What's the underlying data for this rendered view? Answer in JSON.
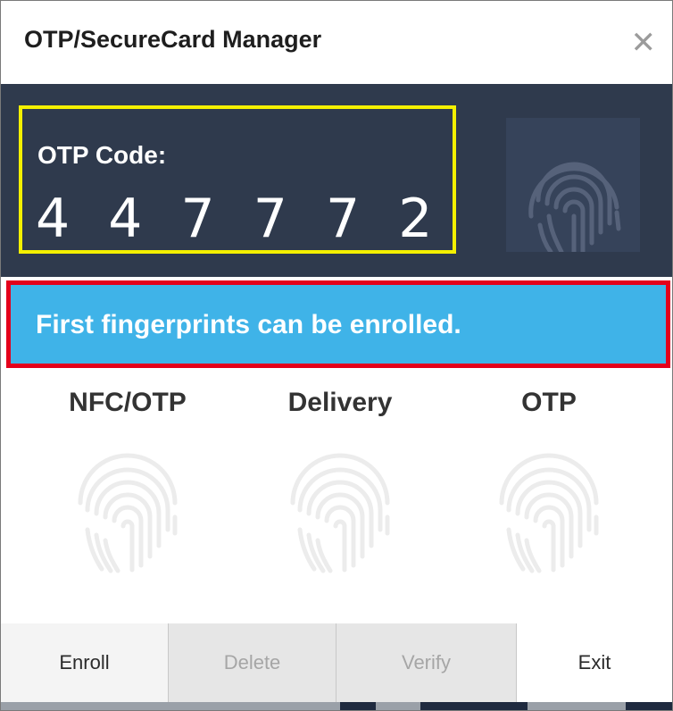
{
  "window": {
    "title": "OTP/SecureCard Manager",
    "close_label": "✕"
  },
  "otp": {
    "label": "OTP Code:",
    "code": "4 4 7 7 7 2"
  },
  "status": {
    "message": "First fingerprints can be enrolled."
  },
  "fingerprints": [
    {
      "label": "NFC/OTP",
      "icon": "fingerprint-icon"
    },
    {
      "label": "Delivery",
      "icon": "fingerprint-icon"
    },
    {
      "label": "OTP",
      "icon": "fingerprint-icon"
    }
  ],
  "buttons": {
    "enroll": "Enroll",
    "delete": "Delete",
    "verify": "Verify",
    "exit": "Exit"
  },
  "colors": {
    "header_bg": "#2f3a4d",
    "status_bg": "#3fb3e8",
    "otp_highlight": "#f4f000",
    "status_highlight": "#e4001b"
  }
}
